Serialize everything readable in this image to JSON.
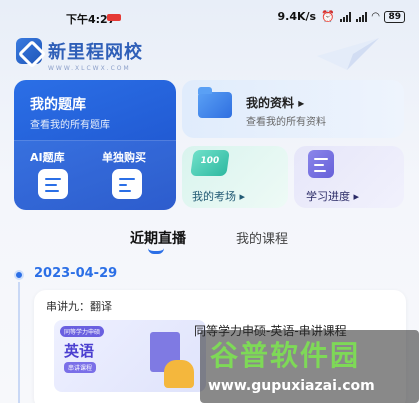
{
  "status_bar": {
    "time": "下午4:27",
    "speed": "9.4K/s",
    "battery": "89"
  },
  "header": {
    "logo_name": "新里程网校",
    "logo_url": "WWW.XLCWX.COM"
  },
  "cards": {
    "question_bank": {
      "title": "我的题库",
      "subtitle": "查看我的所有题库",
      "ai_label": "AI题库",
      "buy_label": "单独购买"
    },
    "materials": {
      "title": "我的资料",
      "subtitle": "查看我的所有资料"
    },
    "exam": {
      "title": "我的考场",
      "icon_text": "100"
    },
    "progress": {
      "title": "学习进度"
    }
  },
  "tabs": {
    "live": "近期直播",
    "courses": "我的课程"
  },
  "timeline": {
    "date": "2023-04-29",
    "item": {
      "subtitle": "串讲九：翻译",
      "title": "同等学力申硕-英语-串讲课程",
      "thumb_badge": "同等学力申硕",
      "thumb_subject": "英语",
      "thumb_tag": "串讲课程"
    }
  },
  "watermark": {
    "title": "谷普软件园",
    "url": "www.gupuxiazai.com"
  },
  "colors": {
    "primary": "#2b6fe6",
    "watermark_green": "#7ed957"
  }
}
